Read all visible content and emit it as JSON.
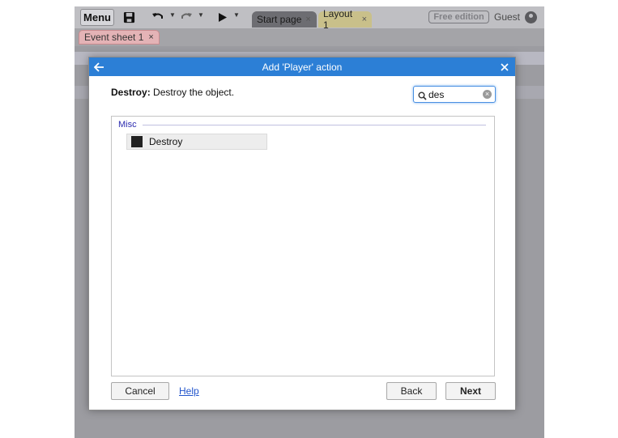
{
  "app": {
    "menu_label": "Menu",
    "tabs": [
      {
        "label": "Start page",
        "close": "×"
      },
      {
        "label": "Layout 1",
        "close": "×"
      }
    ],
    "edition_badge": "Free edition",
    "user_name": "Guest",
    "sheet_tab": {
      "label": "Event sheet 1",
      "close": "×"
    }
  },
  "dialog": {
    "title": "Add 'Player' action",
    "description": {
      "name": "Destroy",
      "separator": ":",
      "text": " Destroy the object."
    },
    "search": {
      "value": "des",
      "placeholder": ""
    },
    "category": "Misc",
    "items": [
      {
        "label": "Destroy"
      }
    ],
    "buttons": {
      "cancel": "Cancel",
      "help": "Help",
      "back": "Back",
      "next": "Next"
    }
  },
  "colors": {
    "title_bar": "#2c7fd6",
    "category_text": "#2b2baf",
    "start_tab": "#6d6d72",
    "layout_tab": "#c9c08a",
    "sheet_tab": "#e4b3b6"
  },
  "icons": [
    "save-icon",
    "undo-icon",
    "redo-icon",
    "play-icon",
    "user-icon",
    "back-arrow-icon",
    "close-icon",
    "search-icon",
    "clear-icon",
    "action-icon"
  ]
}
